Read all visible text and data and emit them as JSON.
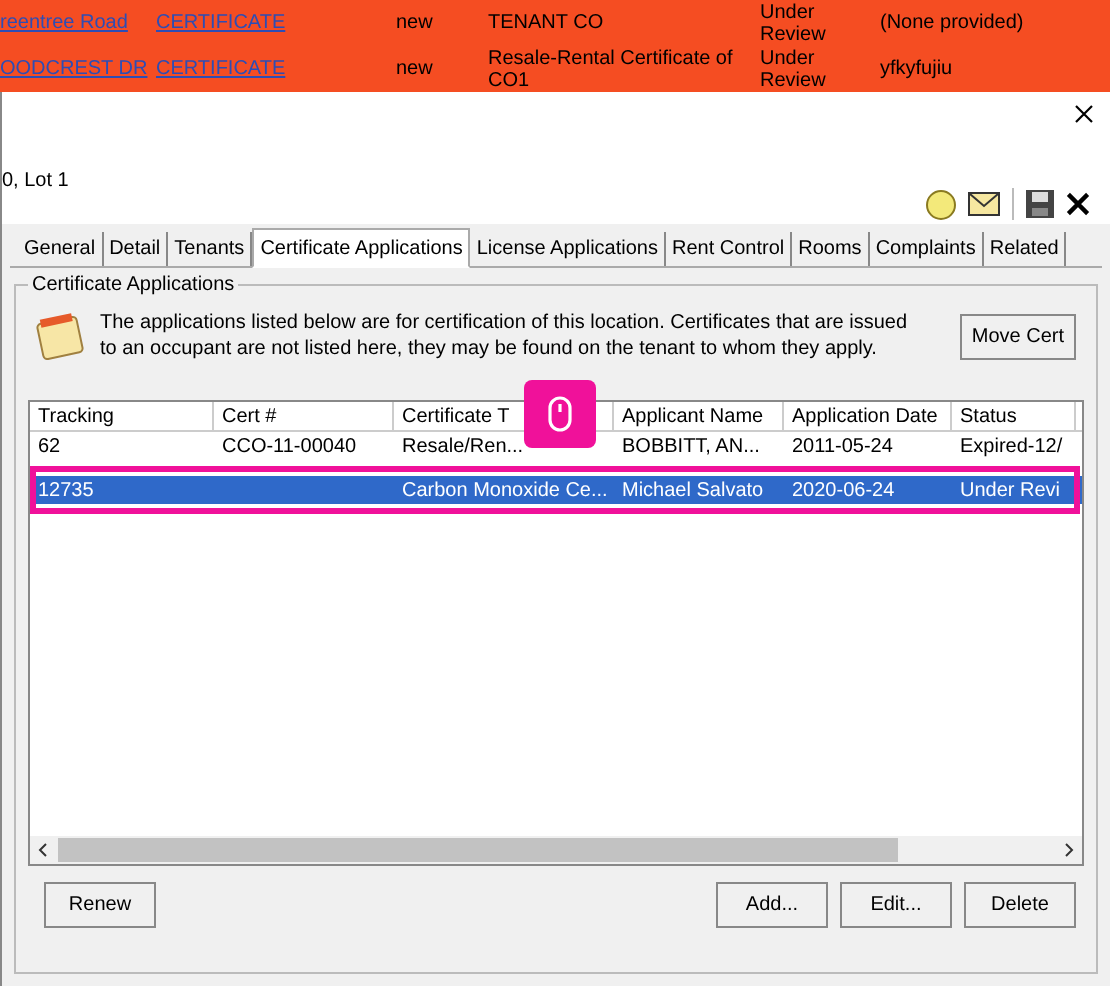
{
  "background_rows": [
    {
      "street": "reentree Road",
      "type": "CERTIFICATE",
      "state": "new",
      "owner": "TENANT CO",
      "status": "Under Review",
      "contact": "(None provided)"
    },
    {
      "street": "OODCREST DR",
      "type": "CERTIFICATE",
      "state": "new",
      "owner": "Resale-Rental Certificate of CO1",
      "status": "Under Review",
      "contact": "yfkyfujiu"
    }
  ],
  "dialog": {
    "location": "0, Lot 1",
    "tabs": [
      {
        "label": "General",
        "selected": false
      },
      {
        "label": "Detail",
        "selected": false
      },
      {
        "label": "Tenants",
        "selected": false
      },
      {
        "label": "Certificate Applications",
        "selected": true
      },
      {
        "label": "License Applications",
        "selected": false
      },
      {
        "label": "Rent Control",
        "selected": false
      },
      {
        "label": "Rooms",
        "selected": false
      },
      {
        "label": "Complaints",
        "selected": false
      },
      {
        "label": "Related",
        "selected": false
      }
    ],
    "group_title": "Certificate Applications",
    "info": "The applications listed below are for certification of this location. Certificates that are issued to an occupant are not listed here, they may be found on the tenant to whom they apply.",
    "move_button": "Move Cert",
    "table": {
      "columns": [
        "Tracking",
        "Cert #",
        "Certificate T",
        "Applicant Name",
        "Application Date",
        "Status"
      ],
      "rows": [
        {
          "cells": [
            "62",
            "CCO-11-00040",
            "Resale/Ren...",
            "BOBBITT, AN...",
            "2011-05-24",
            "Expired-12/"
          ],
          "selected": false
        },
        {
          "cells": [
            "12735",
            "",
            "Carbon Monoxide Ce...",
            "Michael Salvato",
            "2020-06-24",
            "Under Revi"
          ],
          "selected": true
        }
      ]
    },
    "buttons_left": [
      "Renew"
    ],
    "buttons_right": [
      "Add...",
      "Edit...",
      "Delete"
    ]
  }
}
